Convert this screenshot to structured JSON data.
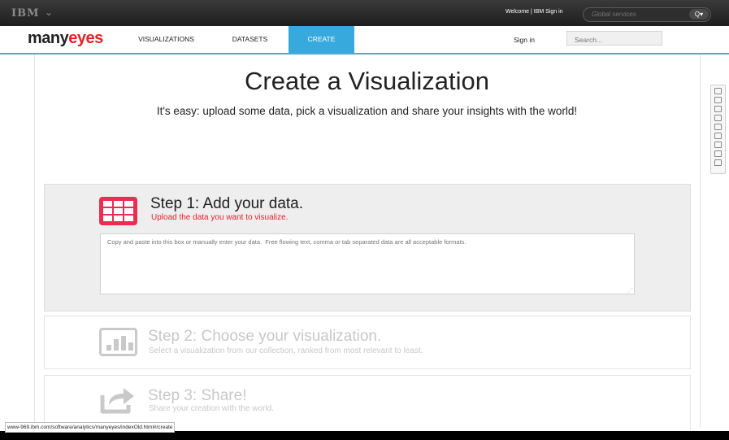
{
  "ibm_bar": {
    "logo": "IBM",
    "chevron": "⌄",
    "welcome": "Welcome | IBM Sign in",
    "search_placeholder": "Global services",
    "search_button": "Q▾"
  },
  "nav": {
    "logo_many": "many",
    "logo_eyes": "eyes",
    "items": [
      {
        "label": "VISUALIZATIONS",
        "active": false
      },
      {
        "label": "DATASETS",
        "active": false
      },
      {
        "label": "CREATE",
        "active": true
      }
    ],
    "sign_in": "Sign in",
    "search_placeholder": "Search..."
  },
  "header": {
    "title": "Create a Visualization",
    "subtitle": "It's easy: upload some data, pick a visualization and share your insights with the world!"
  },
  "steps": [
    {
      "title": "Step 1: Add your data.",
      "subtitle": "Upload the data you want to visualize.",
      "icon": "table-grid-icon",
      "textarea_placeholder": "Copy and paste into this box or manually enter your data.  Free flowing text, comma or tab separated data are all acceptable formats."
    },
    {
      "title": "Step 2: Choose your visualization.",
      "subtitle": "Select a visualization from our collection, ranked from most relevant to least.",
      "icon": "bar-chart-icon"
    },
    {
      "title": "Step 3: Share!",
      "subtitle": "Share your creation with the world.",
      "icon": "share-arrow-icon"
    }
  ],
  "status_url": "www-969.ibm.com/software/analytics/manyeyes/indexOld.html#/create",
  "colors": {
    "accent_blue": "#38a9dc",
    "brand_red": "#e8202a",
    "step1_icon": "#ec2d4f"
  }
}
